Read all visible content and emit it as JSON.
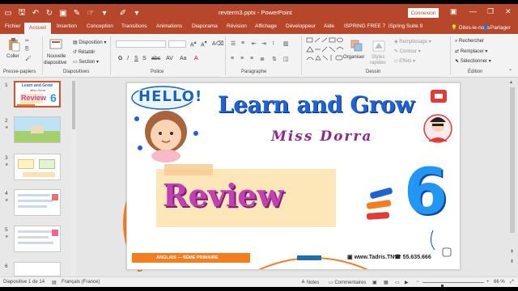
{
  "titlebar": {
    "document_title": "revterm3.pptx - PowerPoint",
    "signin_label": "Connexion"
  },
  "tabs": [
    "Fichier",
    "Accueil",
    "Insertion",
    "Conception",
    "Transitions",
    "Animations",
    "Diaporama",
    "Révision",
    "Affichage",
    "Développeur",
    "Aide",
    "ISPRING FREE 7",
    "iSpring Suite 9"
  ],
  "active_tab": "Accueil",
  "tell_me": "Dites-le-nous",
  "share_label": "Partager",
  "ribbon": {
    "clipboard": {
      "paste": "Coller",
      "group": "Presse-papiers"
    },
    "slides": {
      "new_slide_line1": "Nouvelle",
      "new_slide_line2": "diapositive",
      "layout": "Disposition",
      "reset": "Rétablir",
      "section": "Section",
      "group": "Diapositives"
    },
    "font": {
      "group": "Police"
    },
    "paragraph": {
      "group": "Paragraphe"
    },
    "drawing": {
      "arrange": "Organiser",
      "quick_styles_line1": "Styles",
      "quick_styles_line2": "rapides",
      "fill": "Remplissage",
      "outline": "Contour",
      "effects": "Effets",
      "group": "Dessin"
    },
    "editing": {
      "find": "Rechercher",
      "replace": "Remplacer",
      "select": "Sélectionner",
      "group": "Édition"
    }
  },
  "thumbnails": [
    {
      "num": "1",
      "selected": true
    },
    {
      "num": "2",
      "selected": false
    },
    {
      "num": "3",
      "selected": false
    },
    {
      "num": "4",
      "selected": false
    },
    {
      "num": "5",
      "selected": false
    },
    {
      "num": "6",
      "selected": false
    }
  ],
  "slide": {
    "hello": "HELLO!",
    "title": "Learn and Grow",
    "subtitle": "Miss Dorra",
    "review": "Review",
    "number": "6",
    "footer_left": "ANGLAIS — 6ÈME PRIMAIRE",
    "footer_site": "www.Tadris.TN",
    "footer_phone": "55.635.666",
    "logo_text": "Tadris.TN"
  },
  "thumb1": {
    "title": "Learn and Grow",
    "subtitle": "Miss Dorra",
    "review": "Review",
    "number": "6"
  },
  "status": {
    "slide_counter": "Diapositive 1 de 14",
    "language": "Français (France)",
    "notes": "Notes",
    "comments": "Commentaires",
    "zoom": "66 %",
    "zoom_fraction": 0.66
  },
  "colors": {
    "accent": "#b7472a",
    "title_blue": "#1e63d6",
    "review_magenta": "#c23fb6",
    "footer_orange": "#f57c1f"
  }
}
